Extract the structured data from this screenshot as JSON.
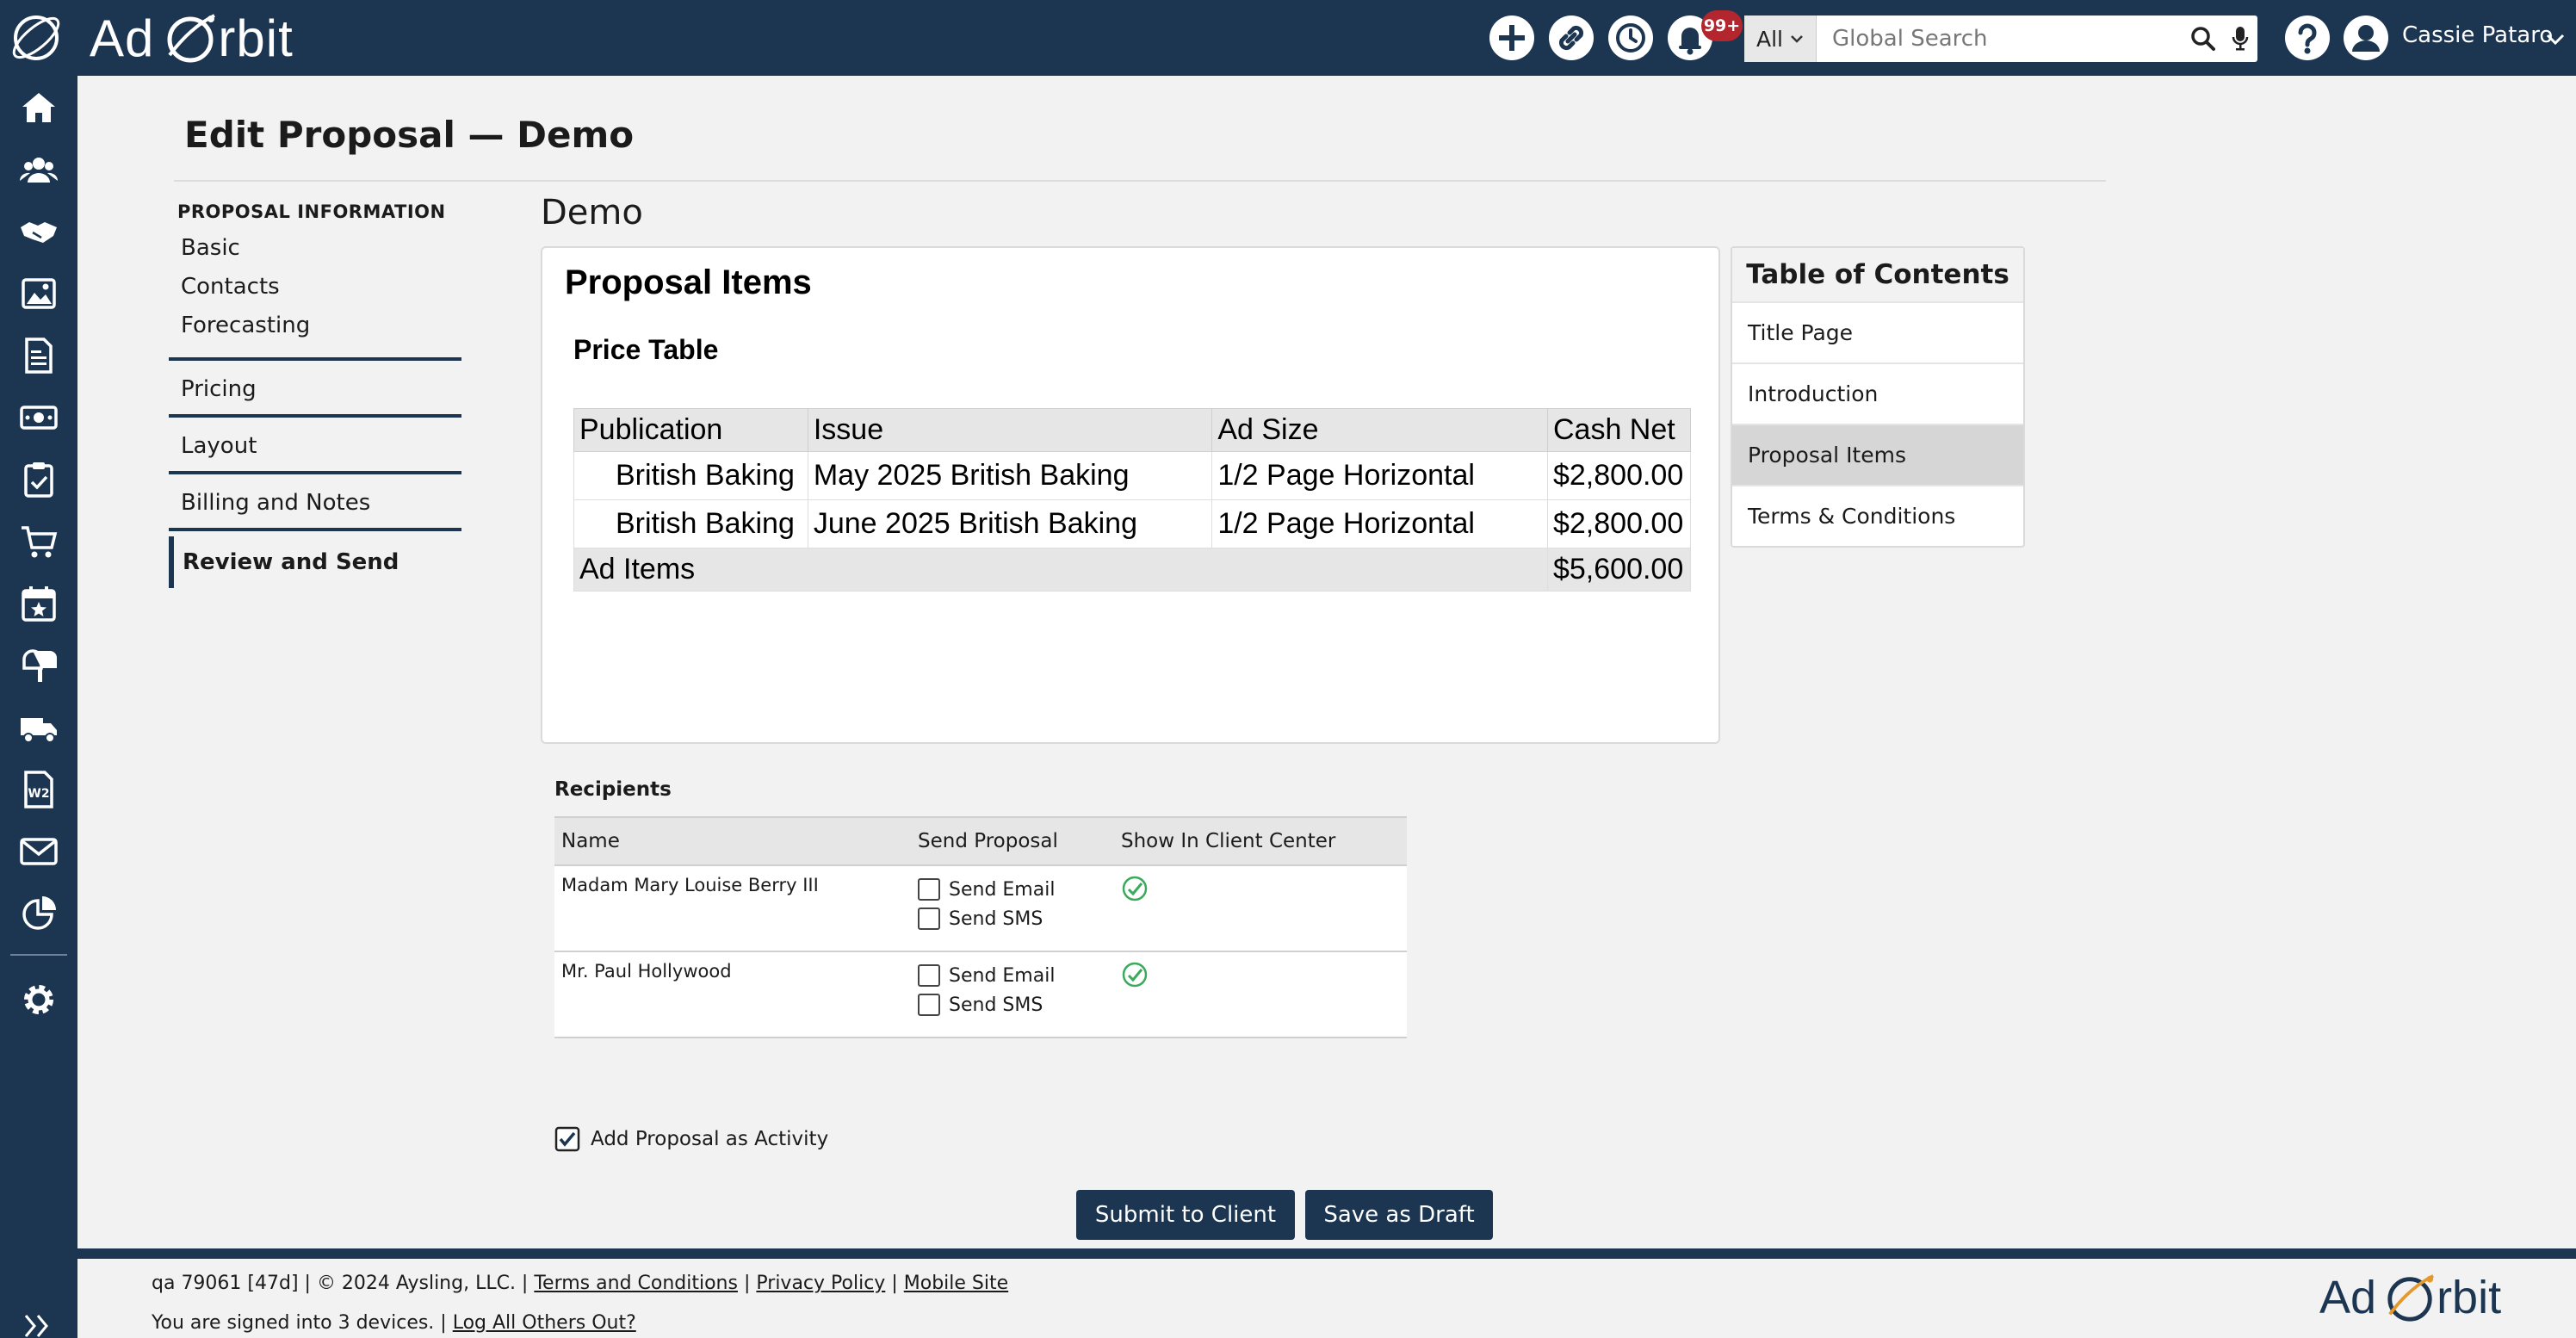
{
  "app": {
    "brand_left": "Ad",
    "brand_right": "rbit",
    "user_name": "Cassie Pataro",
    "notification_badge": "99+",
    "accent_color": "#1c3652",
    "badge_color": "#b3262d"
  },
  "search": {
    "scope": "All",
    "placeholder": "Global Search"
  },
  "topbar_icons": [
    "plus-circle-icon",
    "link-icon",
    "history-clock-icon",
    "bell-icon",
    "help-icon",
    "user-avatar-icon"
  ],
  "sidebar_icons": [
    "home-icon",
    "contacts-icon",
    "handshake-icon",
    "media-icon",
    "invoice-icon",
    "money-icon",
    "clipboard-check-icon",
    "cart-icon",
    "calendar-star-icon",
    "mailbox-icon",
    "truck-icon",
    "w2-form-icon",
    "envelope-icon",
    "pie-chart-icon",
    "settings-gear-icon",
    "collapse-chevron-icon"
  ],
  "page": {
    "title": "Edit Proposal — Demo",
    "section_title": "Demo"
  },
  "left_nav": {
    "header": "PROPOSAL INFORMATION",
    "subitems": [
      "Basic",
      "Contacts",
      "Forecasting"
    ],
    "sections": [
      "Pricing",
      "Layout",
      "Billing and Notes"
    ],
    "active_section": "Review and Send"
  },
  "proposal_doc": {
    "heading": "Proposal Items",
    "subheading": "Price Table",
    "columns": [
      "Publication",
      "Issue",
      "Ad Size",
      "Cash Net"
    ],
    "rows": [
      [
        "British Baking",
        "May 2025 British Baking",
        "1/2 Page Horizontal",
        "$2,800.00"
      ],
      [
        "British Baking",
        "June 2025 British Baking",
        "1/2 Page Horizontal",
        "$2,800.00"
      ]
    ],
    "total_label": "Ad Items",
    "total_value": "$5,600.00"
  },
  "toc": {
    "title": "Table of Contents",
    "items": [
      "Title Page",
      "Introduction",
      "Proposal Items",
      "Terms & Conditions"
    ],
    "selected": "Proposal Items"
  },
  "recipients": {
    "label": "Recipients",
    "columns": [
      "Name",
      "Send Proposal",
      "Show In Client Center"
    ],
    "send_email_label": "Send Email",
    "send_sms_label": "Send SMS",
    "rows": [
      {
        "name": "Madam Mary Louise Berry III"
      },
      {
        "name": "Mr. Paul Hollywood"
      }
    ]
  },
  "activity": {
    "label": "Add Proposal as Activity"
  },
  "actions": {
    "submit_label": "Submit to Client",
    "draft_label": "Save as Draft"
  },
  "footer": {
    "version": "qa 79061 [47d] | © 2024 Aysling, LLC. |",
    "terms": "Terms and Conditions",
    "privacy": "Privacy Policy",
    "mobile": "Mobile Site",
    "sep": "|",
    "devices_text": "You are signed into 3 devices. |",
    "logout_others": "Log All Others Out?"
  }
}
